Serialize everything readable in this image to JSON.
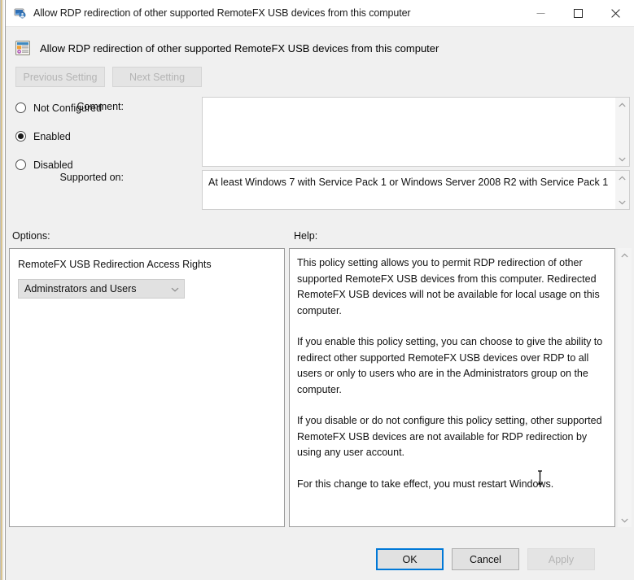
{
  "window": {
    "title": "Allow RDP redirection of other supported RemoteFX USB devices from this computer",
    "icon": "group-policy-icon",
    "controls": {
      "minimize": "Minimize",
      "maximize": "Maximize",
      "close": "Close"
    }
  },
  "header": {
    "icon": "policy-setting-icon",
    "title": "Allow RDP redirection of other supported RemoteFX USB devices from this computer"
  },
  "nav": {
    "previous_label": "Previous Setting",
    "next_label": "Next Setting",
    "previous_enabled": false,
    "next_enabled": false
  },
  "state": {
    "options": [
      {
        "label": "Not Configured",
        "selected": false
      },
      {
        "label": "Enabled",
        "selected": true
      },
      {
        "label": "Disabled",
        "selected": false
      }
    ]
  },
  "comment": {
    "label": "Comment:",
    "value": "",
    "placeholder": ""
  },
  "supported": {
    "label": "Supported on:",
    "value": "At least Windows 7 with Service Pack 1 or Windows Server 2008 R2 with Service Pack 1"
  },
  "options_panel": {
    "label": "Options:",
    "setting_title": "RemoteFX USB Redirection Access Rights",
    "dropdown": {
      "value": "Adminstrators and Users",
      "chevron": "chevron-down-icon"
    }
  },
  "help_panel": {
    "label": "Help:",
    "paragraphs": [
      "This policy setting allows you to permit RDP redirection of other supported RemoteFX USB devices from this computer. Redirected RemoteFX USB devices will not be available for local usage on this computer.",
      "If you enable this policy setting, you can choose to give the ability to redirect other supported RemoteFX USB devices over RDP to all users or only to users who are in the Administrators group on the computer.",
      "If you disable or do not configure this policy setting, other supported RemoteFX USB devices are not available for RDP redirection by using any user account.",
      "For this change to take effect, you must restart Windows."
    ]
  },
  "footer": {
    "ok_label": "OK",
    "cancel_label": "Cancel",
    "apply_label": "Apply",
    "apply_enabled": false
  },
  "colors": {
    "accent": "#0078d7",
    "window_bg": "#f0f0f0",
    "titlebar_bg": "#ffffff",
    "field_bg": "#ffffff",
    "disabled_text": "#b4b4b4",
    "border": "#9a9a9a"
  },
  "cursor": {
    "type": "ibeam-text-cursor"
  }
}
